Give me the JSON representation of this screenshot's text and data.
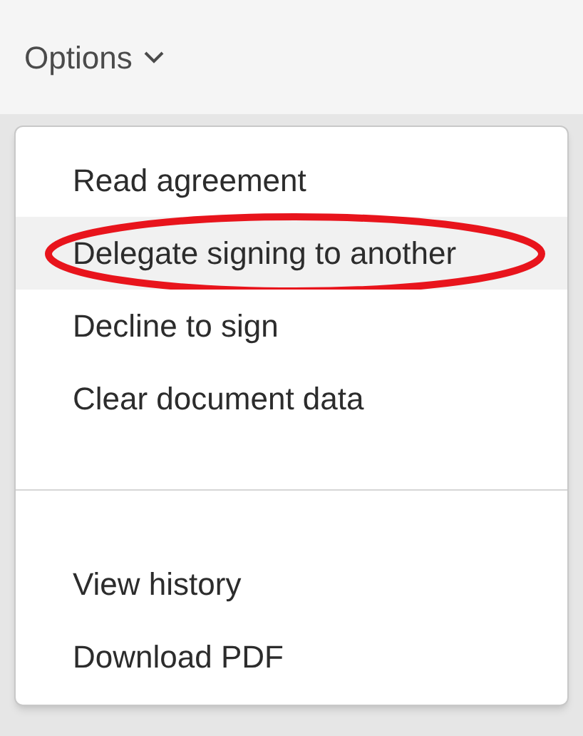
{
  "toolbar": {
    "label": "Options",
    "expanded": true
  },
  "menu": {
    "groups": [
      {
        "items": [
          {
            "label": "Read agreement",
            "highlighted": false,
            "circled": false
          },
          {
            "label": "Delegate signing to another",
            "highlighted": true,
            "circled": true
          },
          {
            "label": "Decline to sign",
            "highlighted": false,
            "circled": false
          },
          {
            "label": "Clear document data",
            "highlighted": false,
            "circled": false
          }
        ]
      },
      {
        "items": [
          {
            "label": "View history",
            "highlighted": false,
            "circled": false
          },
          {
            "label": "Download PDF",
            "highlighted": false,
            "circled": false
          }
        ]
      }
    ]
  }
}
